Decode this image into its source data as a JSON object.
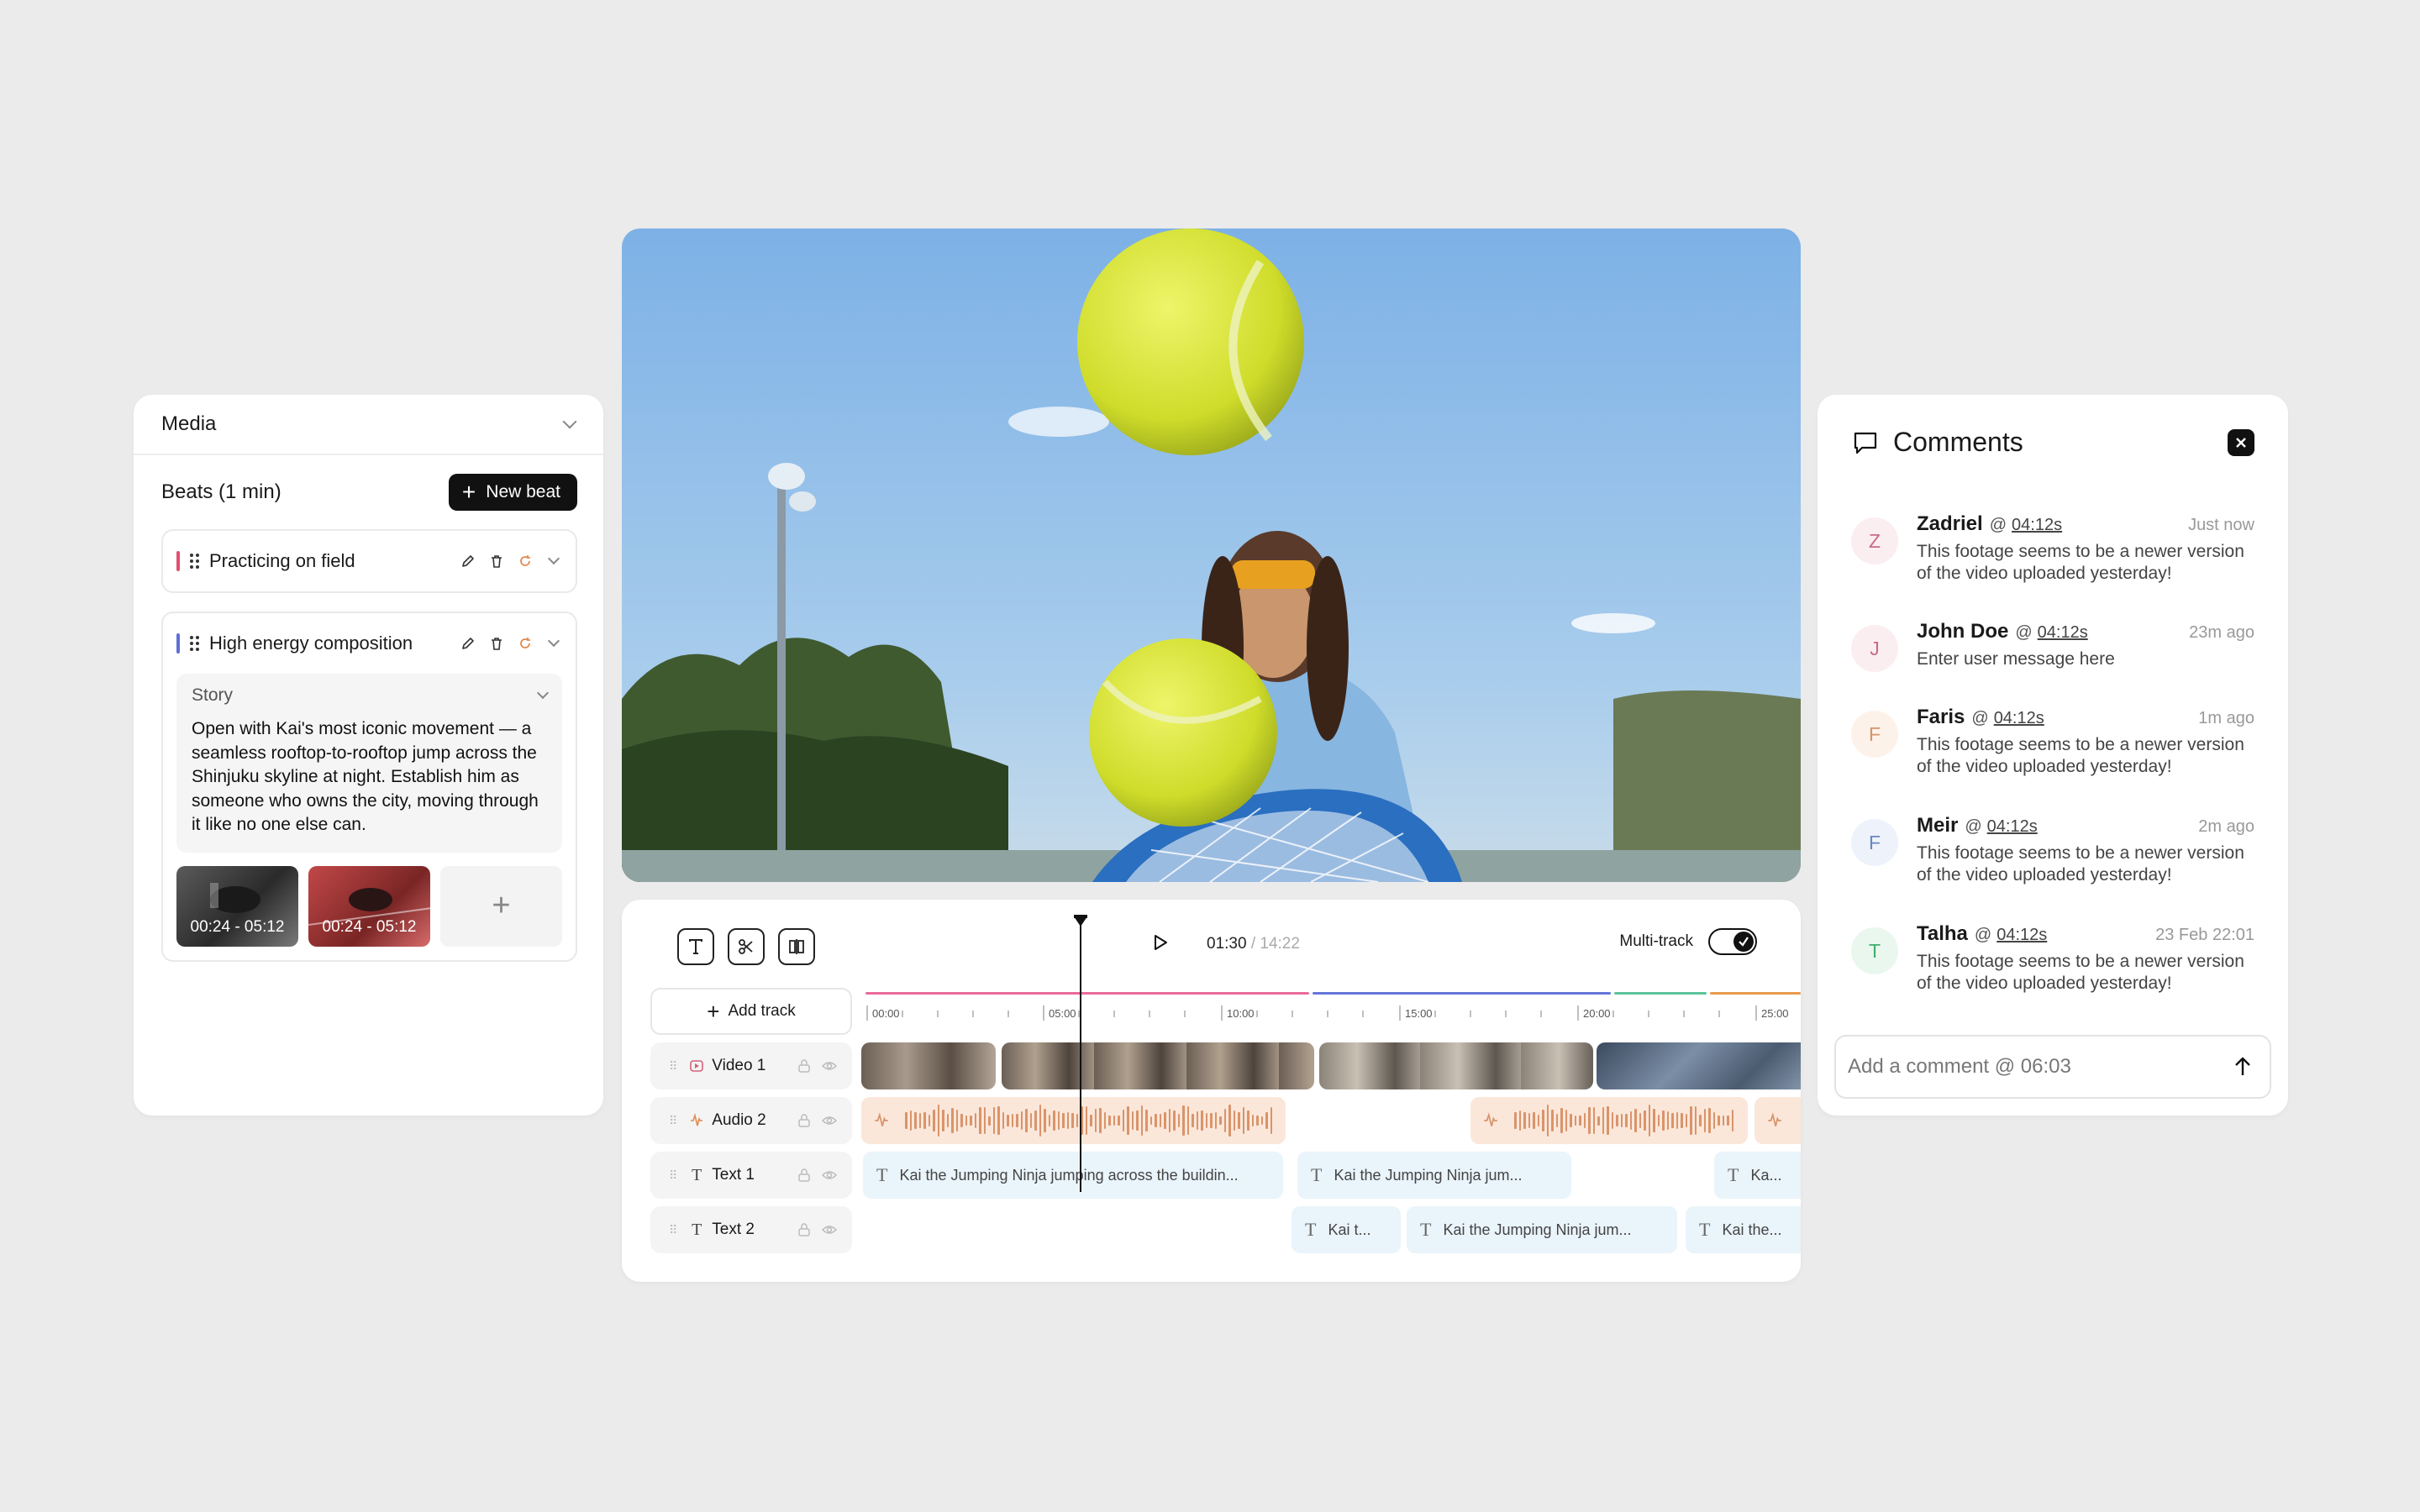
{
  "media": {
    "title": "Media",
    "beats_title": "Beats (1 min)",
    "new_beat_label": "New beat",
    "beats": [
      {
        "label": "Practicing on field",
        "accent": "#e0506e"
      },
      {
        "label": "High energy composition",
        "accent": "#5f6fd6",
        "story_label": "Story",
        "story_text": "Open with Kai's most iconic movement — a seamless rooftop-to-rooftop jump across the Shinjuku skyline at night. Establish him as someone who owns the city, moving through it like no one else can.",
        "thumbs": [
          "00:24 - 05:12",
          "00:24 - 05:12"
        ]
      }
    ]
  },
  "timeline": {
    "current_time": "01:30",
    "total_time": "/ 14:22",
    "multitrack_label": "Multi-track",
    "multitrack_on": true,
    "add_track_label": "Add track",
    "ruler_ticks": [
      "00:00",
      "05:00",
      "10:00",
      "15:00",
      "20:00",
      "25:00"
    ],
    "ruler_segment_colors": [
      "#ea6b9a",
      "#6675d8",
      "#5cc49a",
      "#e89a4c"
    ],
    "tracks": [
      {
        "name": "Video 1",
        "type": "video"
      },
      {
        "name": "Audio 2",
        "type": "audio"
      },
      {
        "name": "Text 1",
        "type": "text"
      },
      {
        "name": "Text 2",
        "type": "text"
      }
    ],
    "text1_clips": [
      "Kai the Jumping Ninja jumping across the buildin...",
      "Kai the Jumping Ninja jum...",
      "Ka..."
    ],
    "text2_clips": [
      "Kai t...",
      "Kai the Jumping Ninja jum...",
      "Kai the..."
    ]
  },
  "comments": {
    "title": "Comments",
    "items": [
      {
        "initial": "Z",
        "name": "Zadriel",
        "at": "@",
        "timestamp": "04:12s",
        "when": "Just now",
        "message": "This footage seems to be a newer version of the video uploaded yesterday!",
        "avatar_bg": "#fbeef1",
        "avatar_fg": "#c86b88"
      },
      {
        "initial": "J",
        "name": "John Doe",
        "at": "@",
        "timestamp": "04:12s",
        "when": "23m ago",
        "message": "Enter user message here",
        "avatar_bg": "#fbeef1",
        "avatar_fg": "#c86b88"
      },
      {
        "initial": "F",
        "name": "Faris",
        "at": "@",
        "timestamp": "04:12s",
        "when": "1m ago",
        "message": "This footage seems to be a newer version of the video uploaded yesterday!",
        "avatar_bg": "#fdf2ea",
        "avatar_fg": "#d69366"
      },
      {
        "initial": "F",
        "name": "Meir",
        "at": "@",
        "timestamp": "04:12s",
        "when": "2m ago",
        "message": "This footage seems to be a newer version of the video uploaded yesterday!",
        "avatar_bg": "#eef3fb",
        "avatar_fg": "#6a86c2"
      },
      {
        "initial": "T",
        "name": "Talha",
        "at": "@",
        "timestamp": "04:12s",
        "when": "23 Feb 22:01",
        "message": "This footage seems to be a newer version of the video uploaded yesterday!",
        "avatar_bg": "#eaf7ef",
        "avatar_fg": "#3fae6c"
      }
    ],
    "input_placeholder": "Add a comment @ 06:03"
  }
}
